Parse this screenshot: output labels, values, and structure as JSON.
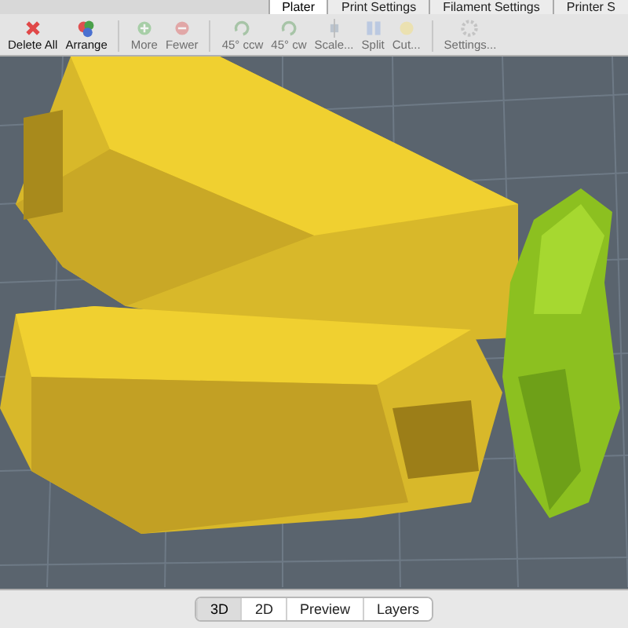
{
  "tabs": [
    {
      "label": "Plater",
      "selected": true
    },
    {
      "label": "Print Settings",
      "selected": false
    },
    {
      "label": "Filament Settings",
      "selected": false
    },
    {
      "label": "Printer S",
      "selected": false
    }
  ],
  "toolbar": [
    {
      "label": "Delete All",
      "disabled": false
    },
    {
      "label": "Arrange",
      "disabled": false
    },
    {
      "label": "More",
      "disabled": true
    },
    {
      "label": "Fewer",
      "disabled": true
    },
    {
      "label": "45° ccw",
      "disabled": true
    },
    {
      "label": "45° cw",
      "disabled": true
    },
    {
      "label": "Scale...",
      "disabled": true
    },
    {
      "label": "Split",
      "disabled": true
    },
    {
      "label": "Cut...",
      "disabled": true
    },
    {
      "label": "Settings...",
      "disabled": true
    }
  ],
  "view_tabs": [
    {
      "label": "3D",
      "selected": true
    },
    {
      "label": "2D",
      "selected": false
    },
    {
      "label": "Preview",
      "selected": false
    },
    {
      "label": "Layers",
      "selected": false
    }
  ]
}
